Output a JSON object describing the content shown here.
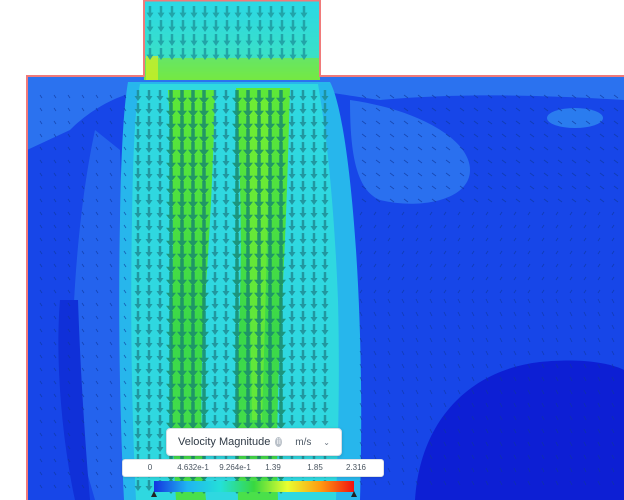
{
  "legend": {
    "title": "Velocity Magnitude",
    "info_icon": "info-icon",
    "unit": "m/s",
    "unit_dropdown_icon": "chevron-down-icon",
    "ticks": [
      "0",
      "4.632e-1",
      "9.264e-1",
      "1.39",
      "1.85",
      "2.316"
    ],
    "range": [
      0,
      2.316
    ],
    "colormap": [
      "#1233e0",
      "#20b4f0",
      "#24e0d8",
      "#38d840",
      "#e8ff30",
      "#ff9a10",
      "#f01010"
    ]
  },
  "colors": {
    "domain_outline": "#f07a7a",
    "background_low": "#1746e8",
    "arrow_fill": "#1e8a8a"
  }
}
